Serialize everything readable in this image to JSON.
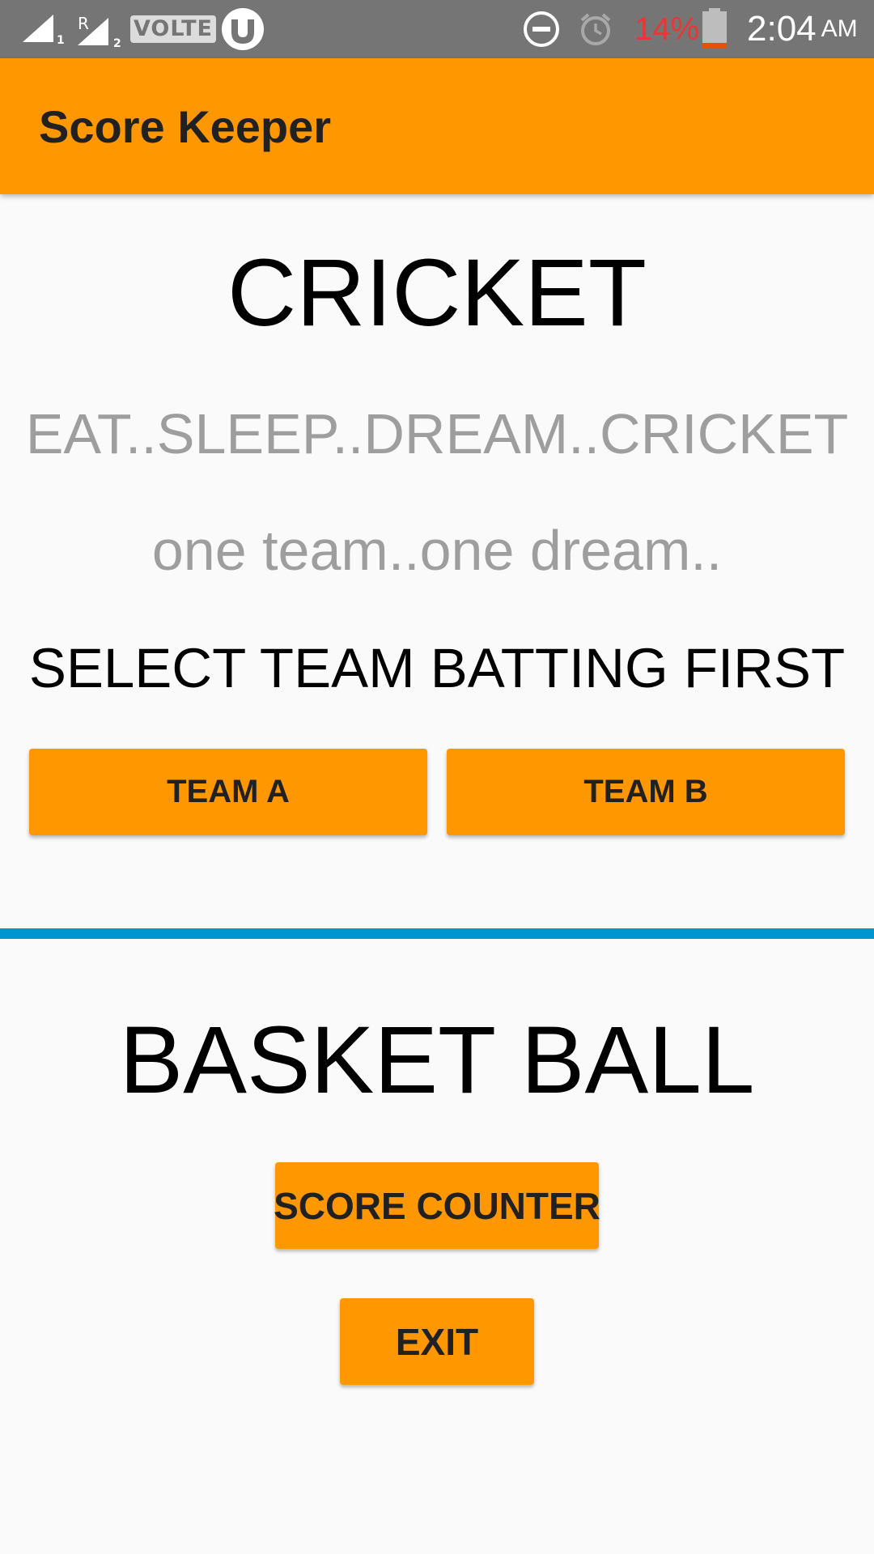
{
  "status_bar": {
    "sim1_label": "1",
    "sim2_roaming": "R",
    "sim2_label": "2",
    "network_badge": "VOLTE",
    "battery_percent": "14%",
    "time": "2:04",
    "ampm": "AM",
    "icons": [
      "signal-icon",
      "signal-roaming-icon",
      "volte-icon",
      "utorrent-icon",
      "do-not-disturb-icon",
      "alarm-icon",
      "battery-low-icon"
    ],
    "colors": {
      "background": "#757575",
      "battery_warning": "#e53935"
    }
  },
  "app_bar": {
    "title": "Score Keeper",
    "color": "#ff9800"
  },
  "cricket": {
    "title": "CRICKET",
    "tagline": "EAT..SLEEP..DREAM..CRICKET",
    "motto": "one team..one dream..",
    "select_prompt": "SELECT TEAM BATTING FIRST",
    "team_a_label": "TEAM A",
    "team_b_label": "TEAM B"
  },
  "divider": {
    "color": "#0095d0"
  },
  "basketball": {
    "title": "BASKET BALL",
    "score_counter_label": "SCORE COUNTER",
    "exit_label": "EXIT"
  },
  "theme": {
    "accent": "#ff9800",
    "background": "#fafafa",
    "button_text": "#212121"
  }
}
